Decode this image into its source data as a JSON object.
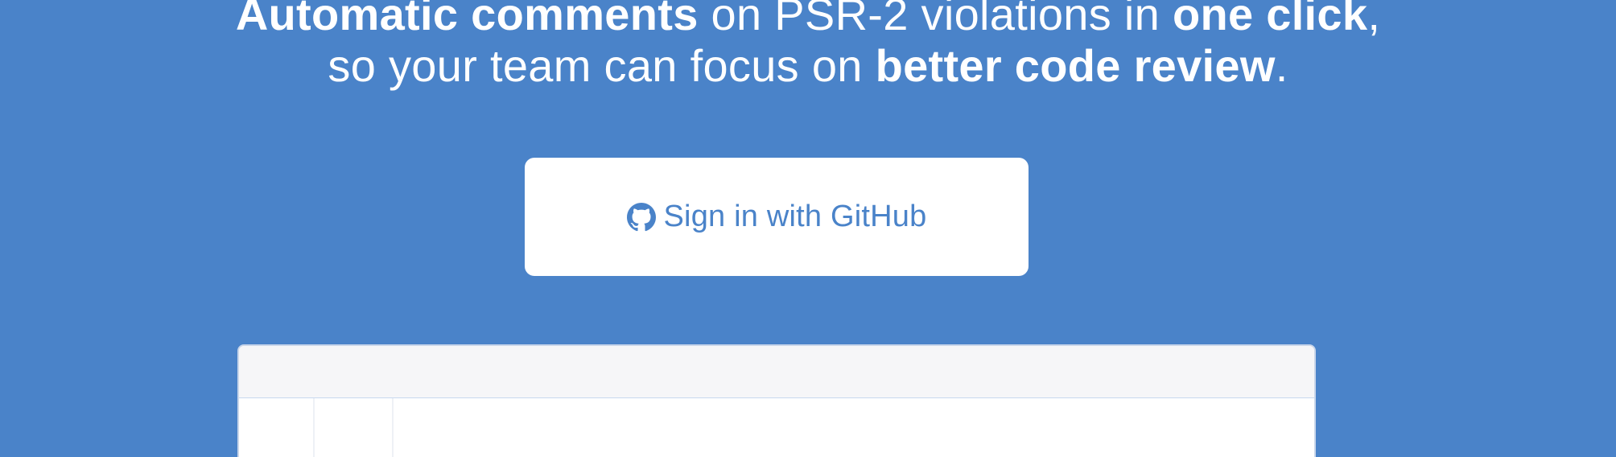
{
  "hero": {
    "line1": {
      "part1": "Automatic comments",
      "part2": " on PSR-2 violations in ",
      "part3": "one click",
      "part4": ","
    },
    "line2": {
      "part1": "so your team can focus on ",
      "part2": "better code review",
      "part3": "."
    }
  },
  "signin_button": {
    "label": "Sign in with GitHub",
    "icon": "github-icon"
  },
  "colors": {
    "background": "#4a83c9",
    "button_bg": "#ffffff",
    "button_text": "#4a83c9",
    "preview_header": "#f6f6f8"
  }
}
